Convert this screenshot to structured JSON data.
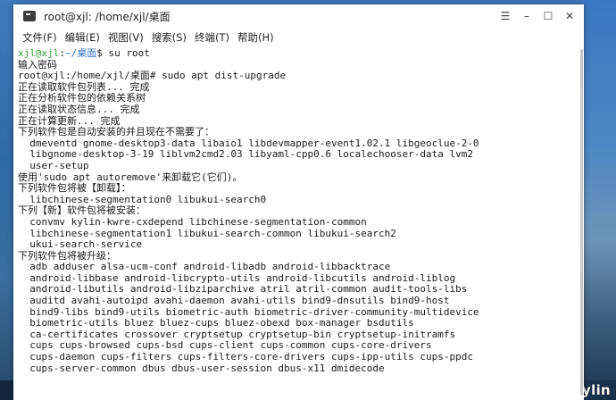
{
  "window": {
    "title": "root@xjl: /home/xjl/桌面",
    "controls": {
      "menu_glyph": "☰",
      "minimize_glyph": "–",
      "maximize_glyph": "☐",
      "close_glyph": "✕"
    }
  },
  "menubar": {
    "items": [
      "文件(F)",
      "编辑(E)",
      "视图(V)",
      "搜索(S)",
      "终端(T)",
      "帮助(H)"
    ]
  },
  "terminal": {
    "prompt": {
      "user_host": "xjl@xjl",
      "separator": ":",
      "path": "~/桌面",
      "symbol": "$",
      "command": " su root"
    },
    "lines": [
      "输入密码",
      "root@xjl:/home/xjl/桌面# sudo apt dist-upgrade",
      "正在读取软件包列表... 完成",
      "正在分析软件包的依赖关系树",
      "正在读取状态信息... 完成",
      "正在计算更新... 完成",
      "下列软件包是自动安装的并且现在不需要了：",
      "  dmeventd gnome-desktop3-data libaio1 libdevmapper-event1.02.1 libgeoclue-2-0",
      "  libgnome-desktop-3-19 liblvm2cmd2.03 libyaml-cpp0.6 localechooser-data lvm2",
      "  user-setup",
      "使用'sudo apt autoremove'来卸载它(它们)。",
      "下列软件包将被【卸载】：",
      "  libchinese-segmentation0 libukui-search0",
      "下列【新】软件包将被安装：",
      "  convmv kylin-kwre-cxdepend libchinese-segmentation-common",
      "  libchinese-segmentation1 libukui-search-common libukui-search2",
      "  ukui-search-service",
      "下列软件包将被升级：",
      "  adb adduser alsa-ucm-conf android-libadb android-libbacktrace",
      "  android-libbase android-libcrypto-utils android-libcutils android-liblog",
      "  android-libutils android-libziparchive atril atril-common audit-tools-libs",
      "  auditd avahi-autoipd avahi-daemon avahi-utils bind9-dnsutils bind9-host",
      "  bind9-libs bind9-utils biometric-auth biometric-driver-community-multidevice",
      "  biometric-utils bluez bluez-cups bluez-obexd box-manager bsdutils",
      "  ca-certificates crossover cryptsetup cryptsetup-bin cryptsetup-initramfs",
      "  cups cups-browsed cups-bsd cups-client cups-common cups-core-drivers",
      "  cups-daemon cups-filters cups-filters-core-drivers cups-ipp-utils cups-ppdc",
      "  cups-server-common dbus dbus-user-session dbus-x11 dmidecode"
    ]
  },
  "watermark": "openKylin",
  "colors": {
    "prompt_user": "#2f9e2f",
    "prompt_path": "#2f6fd0",
    "terminal_bg": "#ffffff",
    "terminal_fg": "#1a1a1a"
  }
}
